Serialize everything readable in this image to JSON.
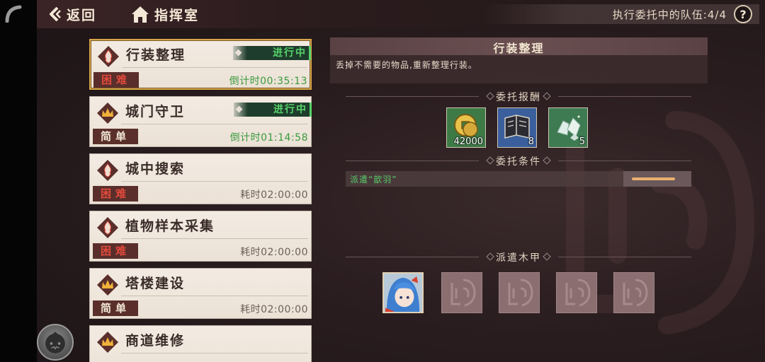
{
  "topbar": {
    "back_label": "返回",
    "home_label": "指挥室",
    "team_status": "执行委托中的队伍:4/4",
    "help_label": "?"
  },
  "tasks": [
    {
      "name": "行装整理",
      "difficulty": "困难",
      "time": "倒计时00:35:13",
      "status": "进行中",
      "selected": true
    },
    {
      "name": "城门守卫",
      "difficulty": "简单",
      "time": "倒计时01:14:58",
      "status": "进行中",
      "selected": false
    },
    {
      "name": "城中搜索",
      "difficulty": "困难",
      "time": "耗时02:00:00",
      "status": "",
      "selected": false
    },
    {
      "name": "植物样本采集",
      "difficulty": "困难",
      "time": "耗时02:00:00",
      "status": "",
      "selected": false
    },
    {
      "name": "塔楼建设",
      "difficulty": "简单",
      "time": "耗时02:00:00",
      "status": "",
      "selected": false
    },
    {
      "name": "商道维修",
      "difficulty": "",
      "time": "",
      "status": "",
      "selected": false
    }
  ],
  "detail": {
    "title": "行装整理",
    "description": "丢掉不需要的物品,重新整理行装。",
    "rewards_header": "委托报酬",
    "rewards": [
      {
        "icon": "coin-icon",
        "count": "42000"
      },
      {
        "icon": "book-icon",
        "count": "8"
      },
      {
        "icon": "crystal-icon",
        "count": "5"
      }
    ],
    "conditions_header": "委托条件",
    "condition_text": "派遣“歆羽”",
    "condition_progress": 0.8,
    "dispatch_header": "派遣木甲",
    "dispatch_slots": [
      "character-portrait",
      "empty",
      "empty",
      "empty",
      "empty"
    ]
  },
  "colors": {
    "accent_gold": "#d9a64a",
    "status_green": "#56d46a",
    "hard_red": "#e0493c",
    "badge_bg": "#5a2f2b"
  }
}
